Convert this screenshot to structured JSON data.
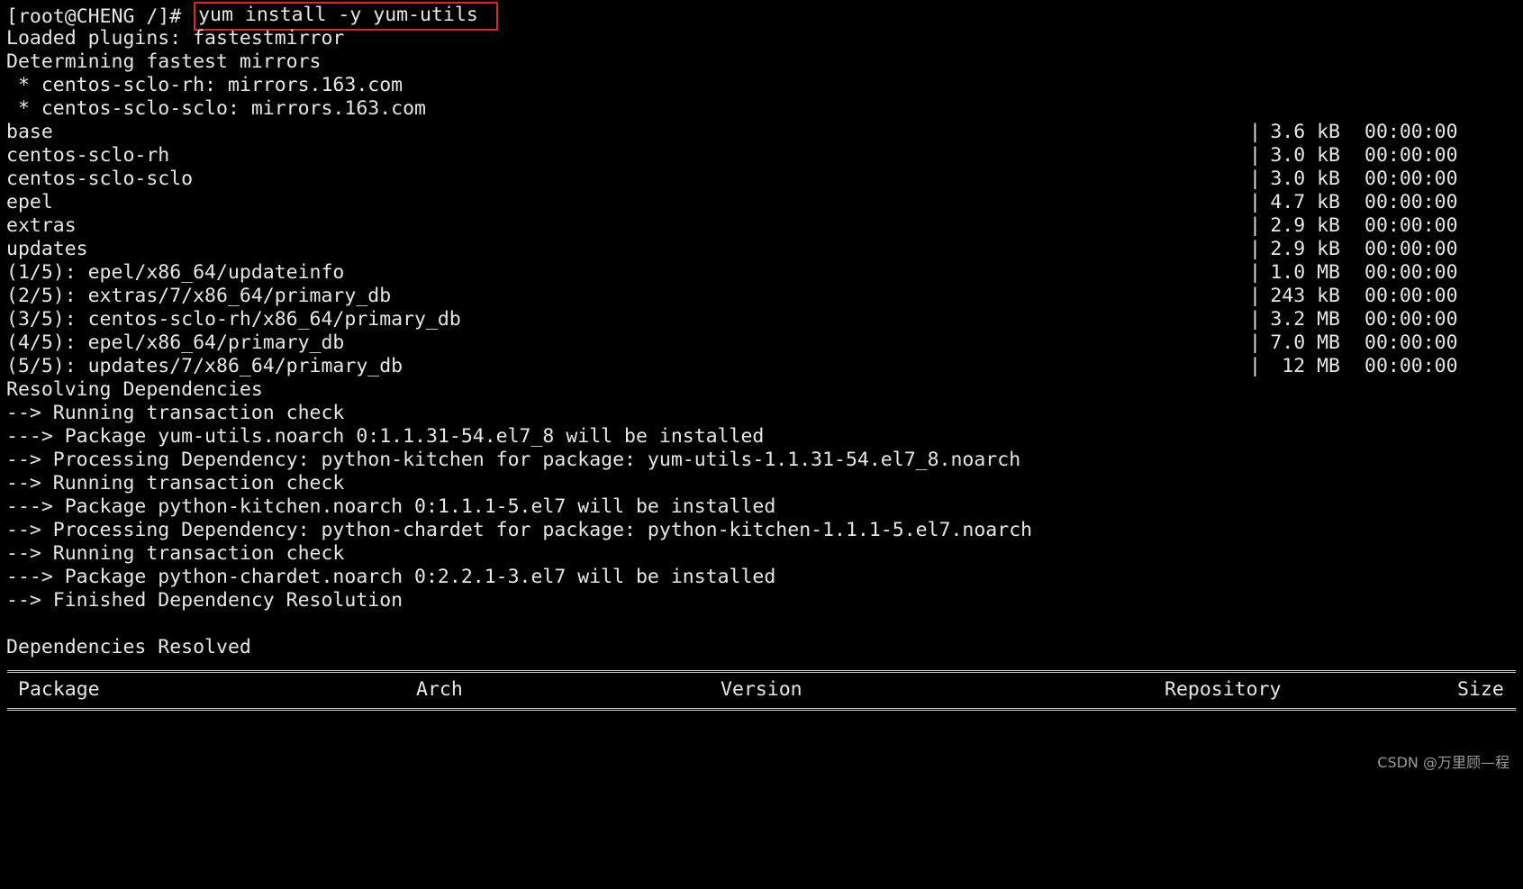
{
  "prompt": "[root@CHENG /]# ",
  "command": "yum install -y yum-utils",
  "preamble": [
    "Loaded plugins: fastestmirror",
    "Determining fastest mirrors",
    " * centos-sclo-rh: mirrors.163.com",
    " * centos-sclo-sclo: mirrors.163.com"
  ],
  "repos": [
    {
      "name": "base",
      "bar": "|",
      "size": "3.6 kB",
      "time": "00:00:00"
    },
    {
      "name": "centos-sclo-rh",
      "bar": "|",
      "size": "3.0 kB",
      "time": "00:00:00"
    },
    {
      "name": "centos-sclo-sclo",
      "bar": "|",
      "size": "3.0 kB",
      "time": "00:00:00"
    },
    {
      "name": "epel",
      "bar": "|",
      "size": "4.7 kB",
      "time": "00:00:00"
    },
    {
      "name": "extras",
      "bar": "|",
      "size": "2.9 kB",
      "time": "00:00:00"
    },
    {
      "name": "updates",
      "bar": "|",
      "size": "2.9 kB",
      "time": "00:00:00"
    },
    {
      "name": "(1/5): epel/x86_64/updateinfo",
      "bar": "|",
      "size": "1.0 MB",
      "time": "00:00:00"
    },
    {
      "name": "(2/5): extras/7/x86_64/primary_db",
      "bar": "|",
      "size": "243 kB",
      "time": "00:00:00"
    },
    {
      "name": "(3/5): centos-sclo-rh/x86_64/primary_db",
      "bar": "|",
      "size": "3.2 MB",
      "time": "00:00:00"
    },
    {
      "name": "(4/5): epel/x86_64/primary_db",
      "bar": "|",
      "size": "7.0 MB",
      "time": "00:00:00"
    },
    {
      "name": "(5/5): updates/7/x86_64/primary_db",
      "bar": "|",
      "size": "12 MB",
      "time": "00:00:00"
    }
  ],
  "resolution": [
    "Resolving Dependencies",
    "--> Running transaction check",
    "---> Package yum-utils.noarch 0:1.1.31-54.el7_8 will be installed",
    "--> Processing Dependency: python-kitchen for package: yum-utils-1.1.31-54.el7_8.noarch",
    "--> Running transaction check",
    "---> Package python-kitchen.noarch 0:1.1.1-5.el7 will be installed",
    "--> Processing Dependency: python-chardet for package: python-kitchen-1.1.1-5.el7.noarch",
    "--> Running transaction check",
    "---> Package python-chardet.noarch 0:2.2.1-3.el7 will be installed",
    "--> Finished Dependency Resolution",
    "",
    "Dependencies Resolved",
    ""
  ],
  "table_header": {
    "package": "Package",
    "arch": "Arch",
    "version": "Version",
    "repository": "Repository",
    "size": "Size"
  },
  "watermark": "CSDN @万里顾—程"
}
